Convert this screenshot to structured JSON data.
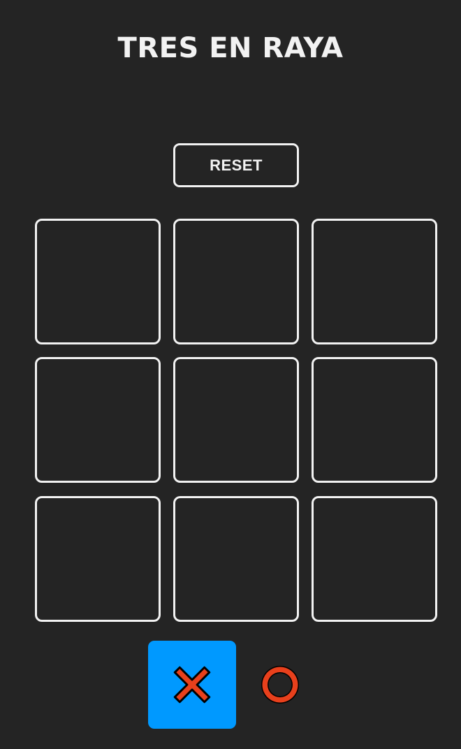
{
  "title": "TRES EN RAYA",
  "reset_label": "RESET",
  "board": {
    "cells": [
      "",
      "",
      "",
      "",
      "",
      "",
      "",
      "",
      ""
    ]
  },
  "turn": {
    "current": "X",
    "players": [
      {
        "symbol": "X",
        "icon": "x-mark-icon"
      },
      {
        "symbol": "O",
        "icon": "o-mark-icon"
      }
    ]
  },
  "colors": {
    "background": "#242424",
    "foreground": "#f2f2f2",
    "active_turn": "#0099ff",
    "mark_fill": "#e8401c",
    "mark_outline": "#000000"
  }
}
